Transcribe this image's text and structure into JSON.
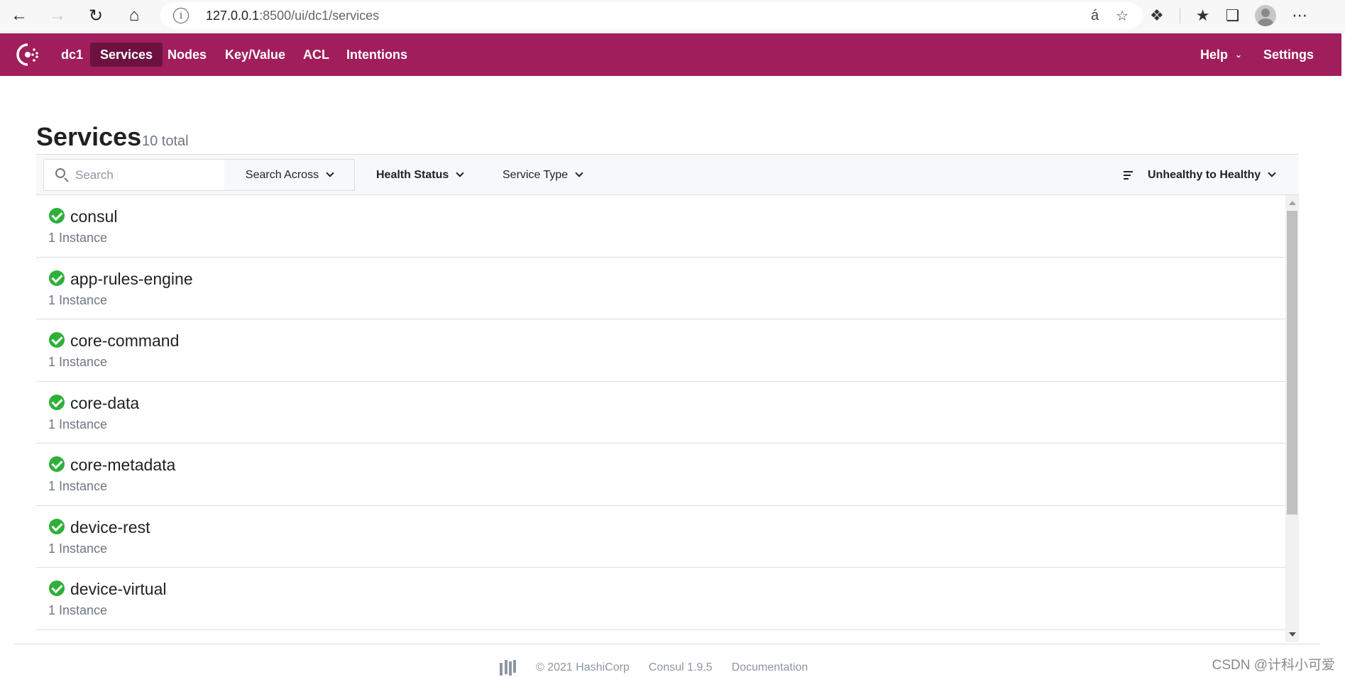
{
  "browser": {
    "url_host": "127.0.0.1",
    "url_rest": ":8500/ui/dc1/services"
  },
  "header": {
    "datacenter": "dc1",
    "nav": [
      "Services",
      "Nodes",
      "Key/Value",
      "ACL",
      "Intentions"
    ],
    "help": "Help",
    "settings": "Settings",
    "accent_color": "#a01e5c",
    "active_color": "#6d1240"
  },
  "page": {
    "title": "Services",
    "count": "10 total"
  },
  "filters": {
    "search_placeholder": "Search",
    "search_across": "Search Across",
    "health_status": "Health Status",
    "service_type": "Service Type",
    "sort": "Unhealthy to Healthy"
  },
  "services": [
    {
      "name": "consul",
      "instances": "1 Instance",
      "status": "passing"
    },
    {
      "name": "app-rules-engine",
      "instances": "1 Instance",
      "status": "passing"
    },
    {
      "name": "core-command",
      "instances": "1 Instance",
      "status": "passing"
    },
    {
      "name": "core-data",
      "instances": "1 Instance",
      "status": "passing"
    },
    {
      "name": "core-metadata",
      "instances": "1 Instance",
      "status": "passing"
    },
    {
      "name": "device-rest",
      "instances": "1 Instance",
      "status": "passing"
    },
    {
      "name": "device-virtual",
      "instances": "1 Instance",
      "status": "passing"
    }
  ],
  "footer": {
    "copyright": "© 2021 HashiCorp",
    "version": "Consul 1.9.5",
    "docs": "Documentation"
  },
  "watermark": "CSDN @计科小可爱"
}
